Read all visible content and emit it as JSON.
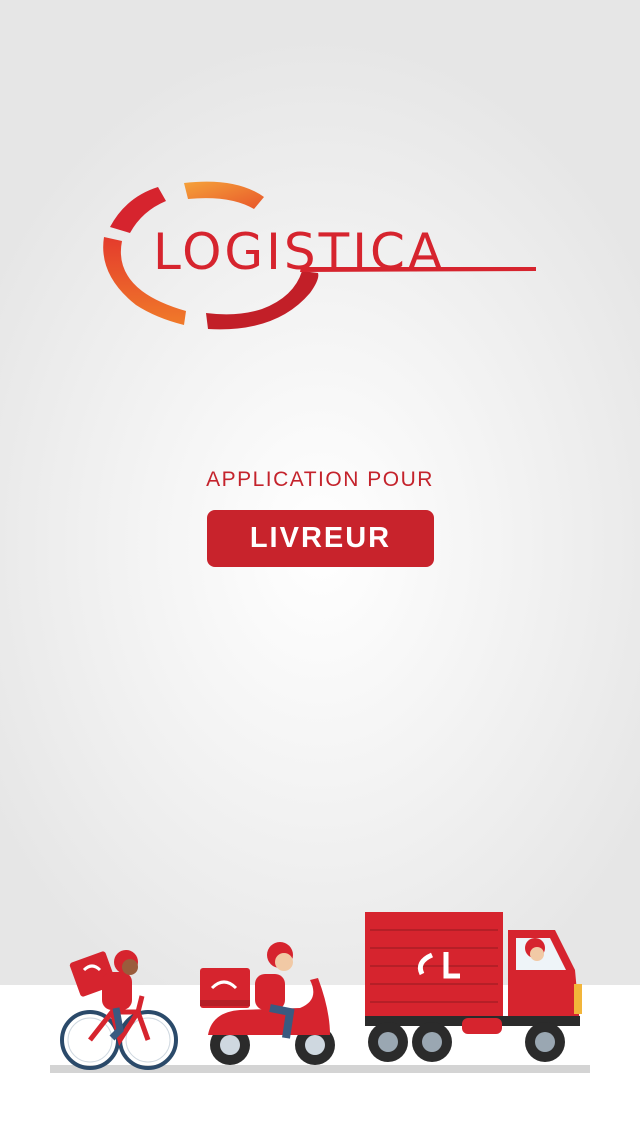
{
  "brand": {
    "name": "LOGISTICA",
    "colors": {
      "primary": "#d6242e",
      "orange": "#f07a2a",
      "dark_red": "#b51f27"
    }
  },
  "splash": {
    "subtitle": "APPLICATION POUR",
    "role_label": "LIVREUR"
  },
  "illustration": {
    "items": [
      "bicycle-courier-icon",
      "scooter-courier-icon",
      "delivery-truck-icon"
    ]
  }
}
